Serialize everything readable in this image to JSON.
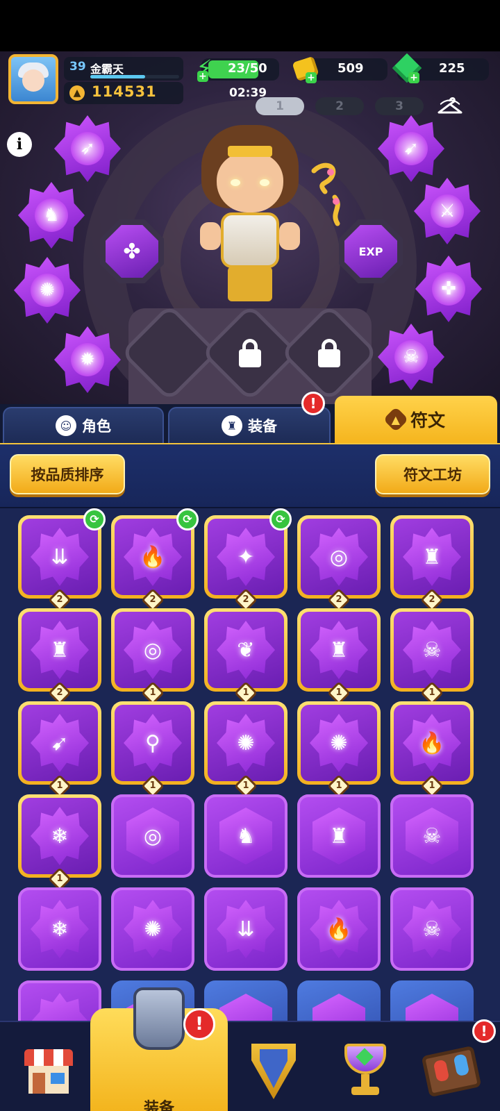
{
  "player": {
    "level": "39",
    "name": "金霸天",
    "xp_fraction": 0.62,
    "power": "114531"
  },
  "resources": {
    "energy": "23/50",
    "energy_fraction": 0.46,
    "gold": "509",
    "gems": "225",
    "timer": "02:39"
  },
  "preset_tabs": [
    "1",
    "2",
    "3"
  ],
  "hero_stage": {
    "center_rune_left": "clover",
    "center_rune_right": "EXP"
  },
  "tabs": {
    "character": "角色",
    "equipment": "装备",
    "runes": "符文"
  },
  "toolbar": {
    "sort_label": "按品质排序",
    "workshop_label": "符文工坊"
  },
  "grid": {
    "rows": [
      [
        {
          "glyph": "⇊",
          "level": "2",
          "swap": true
        },
        {
          "glyph": "🔥",
          "level": "2",
          "swap": true
        },
        {
          "glyph": "✦",
          "level": "2",
          "swap": true
        },
        {
          "glyph": "◎",
          "level": "2",
          "swap": false
        },
        {
          "glyph": "♜",
          "level": "2",
          "swap": false
        }
      ],
      [
        {
          "glyph": "♜",
          "level": "2",
          "swap": false
        },
        {
          "glyph": "◎",
          "level": "1",
          "swap": false
        },
        {
          "glyph": "❦",
          "level": "1",
          "swap": false
        },
        {
          "glyph": "♜",
          "level": "1",
          "swap": false
        },
        {
          "glyph": "☠",
          "level": "1",
          "swap": false
        }
      ],
      [
        {
          "glyph": "➹",
          "level": "1",
          "swap": false
        },
        {
          "glyph": "⚲",
          "level": "1",
          "swap": false
        },
        {
          "glyph": "✺",
          "level": "1",
          "swap": false
        },
        {
          "glyph": "✺",
          "level": "1",
          "swap": false
        },
        {
          "glyph": "🔥",
          "level": "1",
          "swap": false
        }
      ]
    ],
    "row4_first": {
      "glyph": "❄",
      "level": "1"
    },
    "row4_plain": [
      "◎",
      "♞",
      "♜",
      "☠"
    ],
    "row5_plain": [
      "❄",
      "✺",
      "⇊",
      "🔥",
      "☠"
    ]
  },
  "nav": {
    "active_label": "装备",
    "items": [
      "shop",
      "equipment",
      "hero",
      "trophy",
      "board"
    ]
  },
  "colors": {
    "accent_gold": "#f5b51e",
    "rune_purple": "#8a27d4",
    "alert_red": "#e42a2a",
    "swap_green": "#37c43f"
  }
}
